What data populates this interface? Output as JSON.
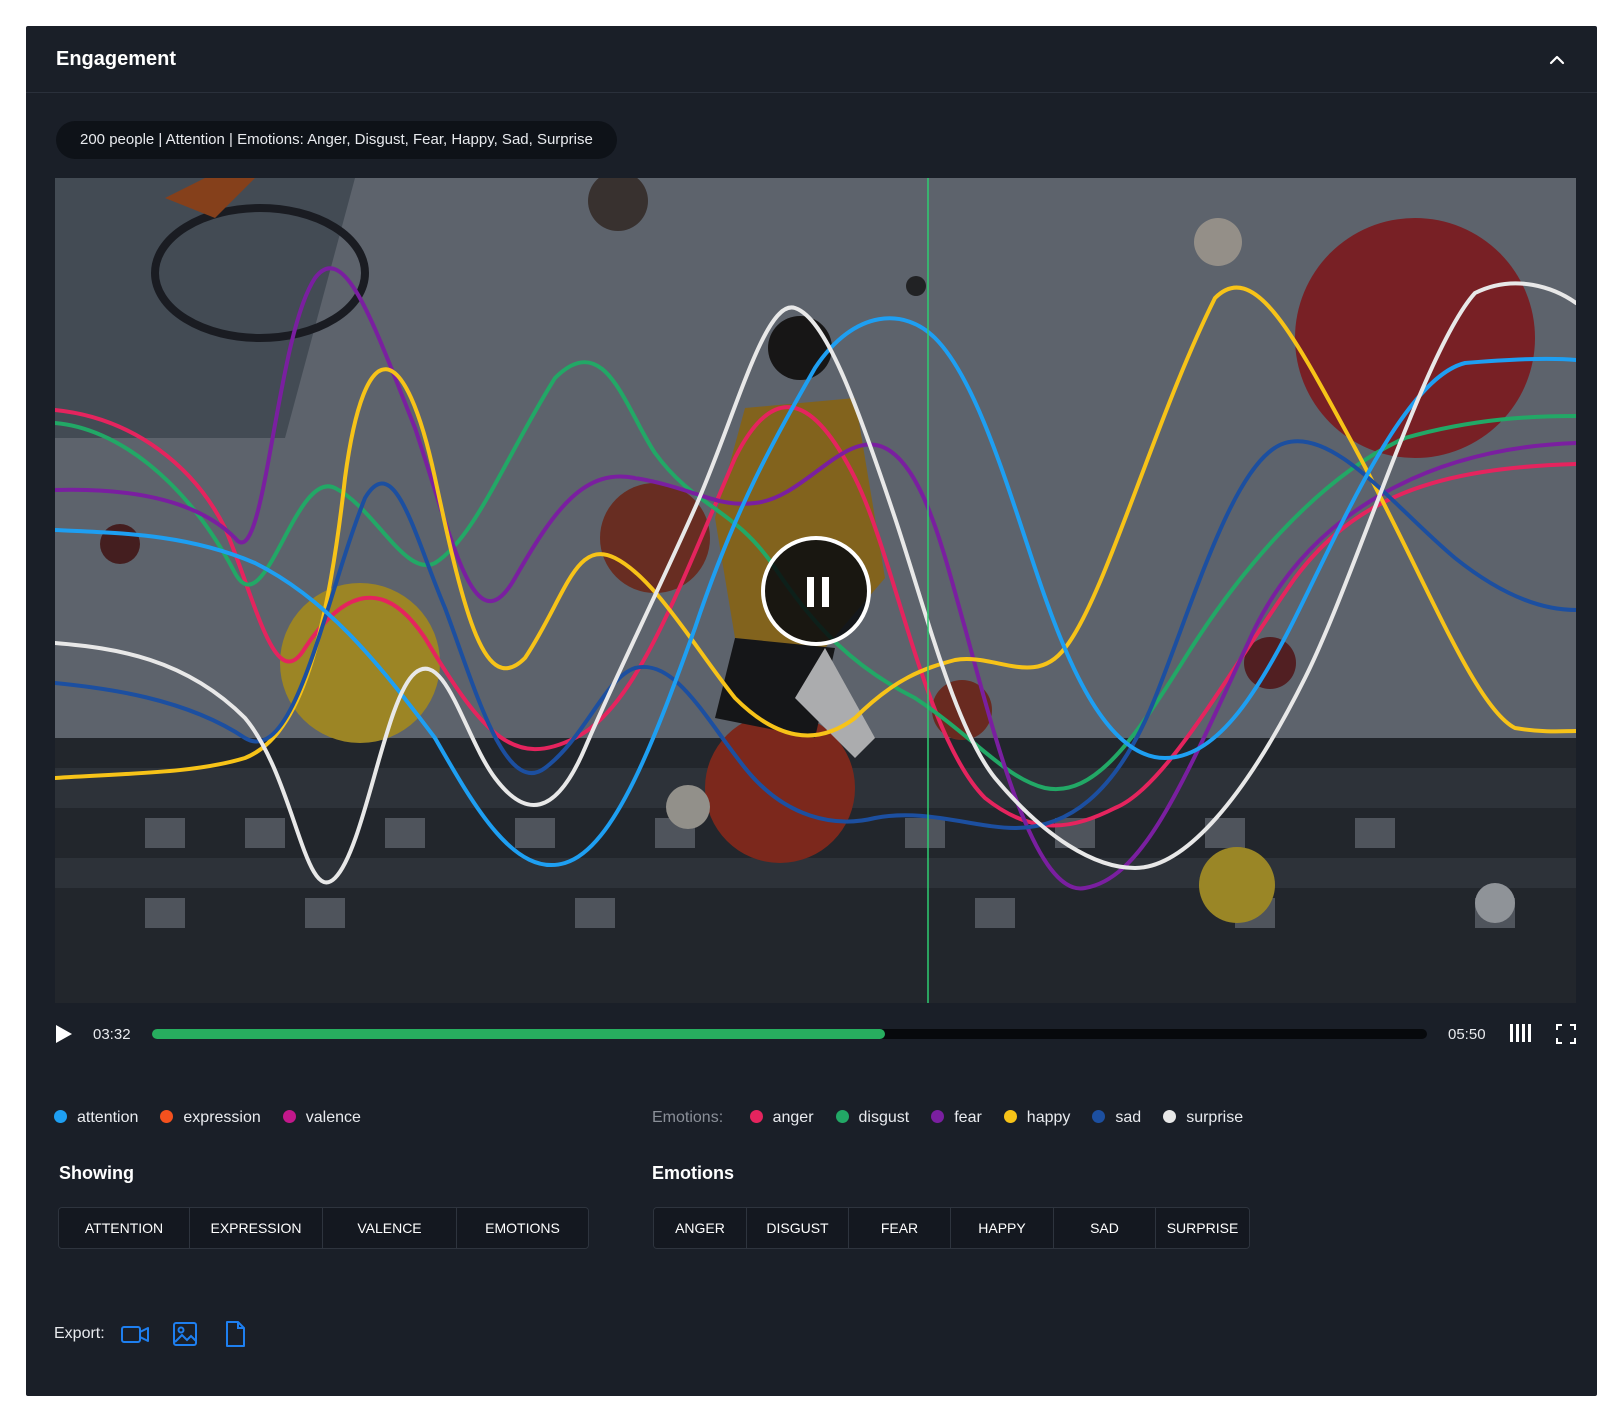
{
  "header": {
    "title": "Engagement"
  },
  "summary": "200 people  |  Attention  |  Emotions: Anger, Disgust, Fear, Happy, Sad, Surprise",
  "player": {
    "current_time": "03:32",
    "total_time": "05:50",
    "progress_fraction": 0.575,
    "state": "playing"
  },
  "legend_primary": [
    {
      "label": "attention",
      "color": "#1e9ff2"
    },
    {
      "label": "expression",
      "color": "#f4511e"
    },
    {
      "label": "valence",
      "color": "#c2188b"
    }
  ],
  "legend_emotions": {
    "prefix": "Emotions:",
    "items": [
      {
        "label": "anger",
        "color": "#e5245e"
      },
      {
        "label": "disgust",
        "color": "#22a866"
      },
      {
        "label": "fear",
        "color": "#7a1fa0"
      },
      {
        "label": "happy",
        "color": "#f7c318"
      },
      {
        "label": "sad",
        "color": "#1c4fa0"
      },
      {
        "label": "surprise",
        "color": "#e8e8e8"
      }
    ]
  },
  "showing": {
    "label": "Showing",
    "buttons": [
      "ATTENTION",
      "EXPRESSION",
      "VALENCE",
      "EMOTIONS"
    ]
  },
  "emotions": {
    "label": "Emotions",
    "buttons": [
      "ANGER",
      "DISGUST",
      "FEAR",
      "HAPPY",
      "SAD",
      "SURPRISE"
    ]
  },
  "export": {
    "label": "Export:"
  },
  "icons": [
    "chevron-up-icon",
    "pause-icon",
    "play-icon",
    "columns-icon",
    "fullscreen-icon",
    "video-icon",
    "image-icon",
    "file-icon"
  ],
  "accent_color": "#27ae5f"
}
